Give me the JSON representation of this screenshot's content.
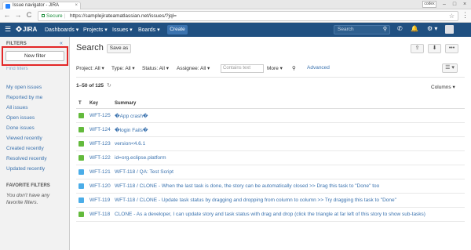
{
  "browser": {
    "tab_title": "Issue navigator - JIRA",
    "tab_close": "×",
    "user_badge": "codex",
    "min": "–",
    "max": "□",
    "close": "×",
    "back": "←",
    "forward": "→",
    "reload": "C",
    "secure_label": "Secure",
    "url": "https://samplejirateamatlassian.net/issues/?jql=",
    "star": "☆",
    "menu": "⋮"
  },
  "header": {
    "logo": "JIRA",
    "nav": [
      "Dashboards ▾",
      "Projects ▾",
      "Issues ▾",
      "Boards ▾"
    ],
    "create": "Create",
    "search_placeholder": "Search",
    "search_icon": "⚲",
    "icons": [
      "✆",
      "🔔",
      "⚙ ▾"
    ]
  },
  "sidebar": {
    "heading": "FILTERS",
    "collapse": "«",
    "new_filter": "New filter",
    "find_filters": "Find filters",
    "links": [
      "My open issues",
      "Reported by me",
      "All issues",
      "Open issues",
      "Done issues",
      "Viewed recently",
      "Created recently",
      "Resolved recently",
      "Updated recently"
    ],
    "favorites_heading": "FAVORITE FILTERS",
    "favorites_text": "You don't have any favorite filters."
  },
  "main": {
    "title": "Search",
    "save_as": "Save as",
    "top_icons": [
      "⇪",
      "⬇",
      "•••"
    ],
    "filters": [
      "Project: All ▾",
      "Type: All ▾",
      "Status: All ▾",
      "Assignee: All ▾"
    ],
    "contains_placeholder": "Contains text",
    "more": "More ▾",
    "search_icon": "⚲",
    "advanced": "Advanced",
    "list_view": "☰ ▾",
    "count": "1–50 of 125",
    "refresh": "↻",
    "columns": "Columns ▾",
    "headers": [
      "T",
      "Key",
      "Summary"
    ]
  },
  "issues": [
    {
      "type": "story",
      "key": "WFT-125",
      "summary": "�App crash�"
    },
    {
      "type": "story",
      "key": "WFT-124",
      "summary": "�login Fails�"
    },
    {
      "type": "story",
      "key": "WFT-123",
      "summary": "version<4.6.1"
    },
    {
      "type": "story",
      "key": "WFT-122",
      "summary": "id=org.eclipse.platform"
    },
    {
      "type": "task",
      "key": "WFT-121",
      "summary": "WFT-118 / QA: Test Script"
    },
    {
      "type": "task",
      "key": "WFT-120",
      "summary": "WFT-118 / CLONE - When the last task is done, the story can be automatically closed >> Drag this task to \"Done\" too"
    },
    {
      "type": "task",
      "key": "WFT-119",
      "summary": "WFT-118 / CLONE - Update task status by dragging and dropping from column to column >> Try dragging this task to \"Done\""
    },
    {
      "type": "story",
      "key": "WFT-118",
      "summary": "CLONE - As a developer, I can update story and task status with drag and drop (click the triangle at far left of this story to show sub-tasks)"
    }
  ],
  "colors": {
    "jira_blue": "#205081",
    "create_blue": "#3b73af",
    "link": "#3b73af",
    "highlight_red": "#e32727",
    "story_green": "#63ba3c",
    "task_blue": "#4bade8"
  }
}
